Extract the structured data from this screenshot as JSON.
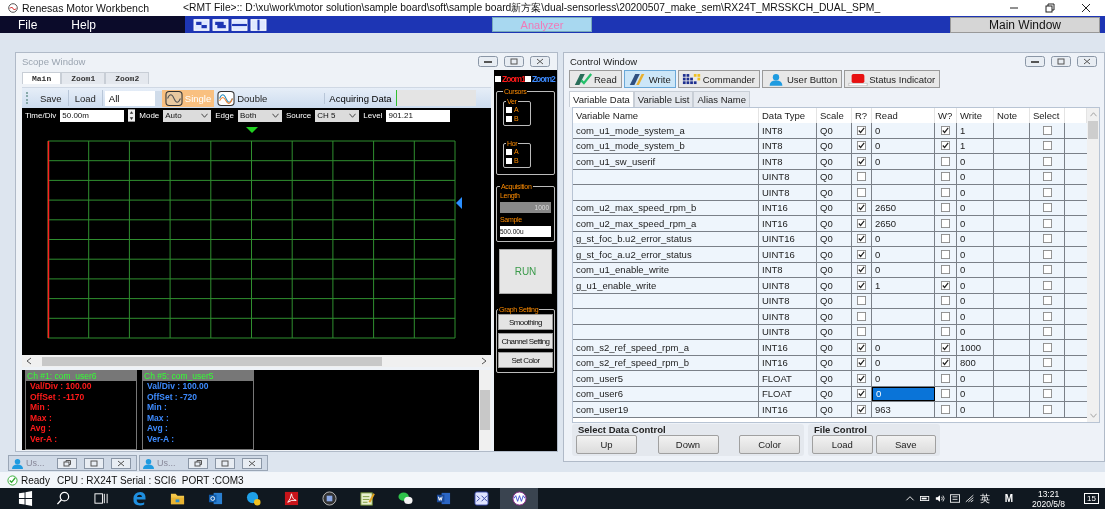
{
  "title_bar": {
    "app": "Renesas Motor Workbench",
    "file": "<RMT File>:: D:\\xu\\work\\motor solution\\sample board\\soft\\sample board新方案\\dual-sensorless\\20200507_make_sem\\RX24T_MRSSKCH_DUAL_SPM_"
  },
  "menu": [
    "File",
    "Help"
  ],
  "analyzer_button": "Analyzer",
  "main_window_button": "Main Window",
  "scope_window": {
    "title": "Scope Window",
    "tabs": [
      {
        "label": "Main",
        "selected": true
      },
      {
        "label": "Zoom1",
        "selected": false
      },
      {
        "label": "Zoom2",
        "selected": false
      }
    ],
    "toolbar": {
      "save": "Save",
      "load": "Load",
      "filter": "All",
      "modes": [
        {
          "label": "Single",
          "selected": true
        },
        {
          "label": "Double",
          "selected": false
        }
      ],
      "acquiring": "Acquiring Data",
      "progress": {
        "level": 0.02
      }
    },
    "trigger": {
      "time_div_label": "Time/Div",
      "time_div": "50.00m",
      "mode_label": "Mode",
      "mode": "Auto",
      "edge_label": "Edge",
      "edge": "Both",
      "source_label": "Source",
      "source": "CH 5",
      "level_label": "Level",
      "level": "901.21"
    },
    "channels": [
      {
        "title": "Ch #1: com_user6",
        "color": "#ff1a1a",
        "lines": [
          "Val/Div : 100.00",
          "OffSet : -1170",
          "Min :",
          "Max :",
          "Avg :",
          "Ver-A :"
        ]
      },
      {
        "title": "Ch #5: com_user5",
        "color": "#3d8bff",
        "lines": [
          "Val/Div : 100.00",
          "OffSet : -720",
          "Min :",
          "Max :",
          "Avg :",
          "Ver-A :"
        ]
      }
    ],
    "side": {
      "zoom_checks": [
        {
          "label": "Zoom1",
          "checked": false,
          "color": "#ff1a1a"
        },
        {
          "label": "Zoom2",
          "checked": false,
          "color": "#3d8bff"
        }
      ],
      "cursors_title": "Cursors",
      "cursor_groups": [
        {
          "title": "Ver",
          "items": [
            {
              "label": "A",
              "checked": false
            },
            {
              "label": "B",
              "checked": false
            }
          ]
        },
        {
          "title": "Hor",
          "items": [
            {
              "label": "A",
              "checked": false
            },
            {
              "label": "B",
              "checked": false
            }
          ]
        }
      ],
      "acquisition_title": "Acquisition",
      "length_label": "Length",
      "length": "1000",
      "sample_label": "Sample",
      "sample": "500.00u",
      "run": "RUN",
      "graph_title": "Graph Setting",
      "graph_buttons": [
        "Smoothing",
        "Channel Setting",
        "Set Color"
      ]
    }
  },
  "child_tabs": [
    {
      "label": "Us..."
    },
    {
      "label": "Us..."
    }
  ],
  "control_window": {
    "title": "Control Window",
    "toolbar": [
      {
        "kind": "read",
        "label": "Read",
        "selected": false
      },
      {
        "kind": "write",
        "label": "Write",
        "selected": true
      },
      {
        "kind": "commander",
        "label": "Commander",
        "selected": false
      },
      {
        "kind": "user",
        "label": "User Button",
        "selected": false
      },
      {
        "kind": "indicator",
        "label": "Status Indicator",
        "selected": false
      }
    ],
    "tabs": [
      {
        "label": "Variable Data",
        "selected": true
      },
      {
        "label": "Variable List",
        "selected": false
      },
      {
        "label": "Alias Name",
        "selected": false
      }
    ],
    "columns": [
      "Variable Name",
      "Data Type",
      "Scale",
      "R?",
      "Read",
      "W?",
      "Write",
      "Note",
      "Select"
    ],
    "rows": [
      {
        "name": "com_u1_mode_system_a",
        "type": "INT8",
        "scale": "Q0",
        "r": true,
        "read": "0",
        "w": true,
        "write": "1",
        "select": false,
        "selected": false
      },
      {
        "name": "com_u1_mode_system_b",
        "type": "INT8",
        "scale": "Q0",
        "r": true,
        "read": "0",
        "w": true,
        "write": "1",
        "select": false,
        "selected": false
      },
      {
        "name": "com_u1_sw_userif",
        "type": "INT8",
        "scale": "Q0",
        "r": true,
        "read": "0",
        "w": false,
        "write": "0",
        "select": false,
        "selected": false
      },
      {
        "type": "UINT8",
        "scale": "Q0",
        "r": false,
        "w": false,
        "write": "0",
        "select": false,
        "selected": false
      },
      {
        "type": "UINT8",
        "scale": "Q0",
        "r": false,
        "w": false,
        "write": "0",
        "select": false,
        "selected": false
      },
      {
        "name": "com_u2_max_speed_rpm_b",
        "type": "INT16",
        "scale": "Q0",
        "r": true,
        "read": "2650",
        "w": false,
        "write": "0",
        "select": false,
        "selected": false
      },
      {
        "name": "com_u2_max_speed_rpm_a",
        "type": "INT16",
        "scale": "Q0",
        "r": true,
        "read": "2650",
        "w": false,
        "write": "0",
        "select": false,
        "selected": false
      },
      {
        "name": "g_st_foc_b.u2_error_status",
        "type": "UINT16",
        "scale": "Q0",
        "r": true,
        "read": "0",
        "w": false,
        "write": "0",
        "select": false,
        "selected": false
      },
      {
        "name": "g_st_foc_a.u2_error_status",
        "type": "UINT16",
        "scale": "Q0",
        "r": true,
        "read": "0",
        "w": false,
        "write": "0",
        "select": false,
        "selected": false
      },
      {
        "name": "com_u1_enable_write",
        "type": "INT8",
        "scale": "Q0",
        "r": true,
        "read": "0",
        "w": false,
        "write": "0",
        "select": false,
        "selected": false
      },
      {
        "name": "g_u1_enable_write",
        "type": "UINT8",
        "scale": "Q0",
        "r": true,
        "read": "1",
        "w": true,
        "write": "0",
        "select": false,
        "selected": false
      },
      {
        "type": "UINT8",
        "scale": "Q0",
        "r": false,
        "w": false,
        "write": "0",
        "select": false,
        "selected": false
      },
      {
        "type": "UINT8",
        "scale": "Q0",
        "r": false,
        "w": false,
        "write": "0",
        "select": false,
        "selected": false
      },
      {
        "type": "UINT8",
        "scale": "Q0",
        "r": false,
        "w": false,
        "write": "0",
        "select": false,
        "selected": false
      },
      {
        "name": "com_s2_ref_speed_rpm_a",
        "type": "INT16",
        "scale": "Q0",
        "r": true,
        "read": "0",
        "w": true,
        "write": "1000",
        "select": false,
        "selected": false
      },
      {
        "name": "com_s2_ref_speed_rpm_b",
        "type": "INT16",
        "scale": "Q0",
        "r": true,
        "read": "0",
        "w": true,
        "write": "800",
        "select": false,
        "selected": false
      },
      {
        "name": "com_user5",
        "type": "FLOAT",
        "scale": "Q0",
        "r": true,
        "read": "0",
        "w": false,
        "write": "0",
        "select": false,
        "selected": false
      },
      {
        "name": "com_user6",
        "type": "FLOAT",
        "scale": "Q0",
        "r": true,
        "read": "0",
        "w": false,
        "write": "0",
        "select": false,
        "selected": true
      },
      {
        "name": "com_user19",
        "type": "INT16",
        "scale": "Q0",
        "r": true,
        "read": "963",
        "w": false,
        "write": "0",
        "select": false,
        "selected": false
      }
    ],
    "select_group": {
      "title": "Select Data Control",
      "buttons": [
        "Up",
        "Down",
        "Color"
      ]
    },
    "file_group": {
      "title": "File Control",
      "buttons": [
        "Load",
        "Save"
      ]
    }
  },
  "status_bar": {
    "ready": "Ready",
    "text": "CPU : RX24T Serial : SCI6  PORT :COM3"
  },
  "taskbar": {
    "items": [
      {
        "kind": "start",
        "selected": false
      },
      {
        "kind": "search",
        "selected": false
      },
      {
        "kind": "taskview",
        "selected": false
      },
      {
        "kind": "browser",
        "selected": false
      },
      {
        "kind": "folder",
        "selected": false
      },
      {
        "kind": "mail",
        "selected": false
      },
      {
        "kind": "call",
        "selected": false
      },
      {
        "kind": "pdf",
        "selected": false
      },
      {
        "kind": "disc",
        "selected": false
      },
      {
        "kind": "notepad",
        "selected": false
      },
      {
        "kind": "chat",
        "selected": false
      },
      {
        "kind": "word",
        "selected": false
      },
      {
        "kind": "grid",
        "selected": false
      },
      {
        "kind": "wave",
        "selected": true
      }
    ],
    "tray": {
      "ime": "英",
      "m": "M",
      "time": "13:21",
      "date": "2020/5/8",
      "notifications": "15"
    }
  }
}
